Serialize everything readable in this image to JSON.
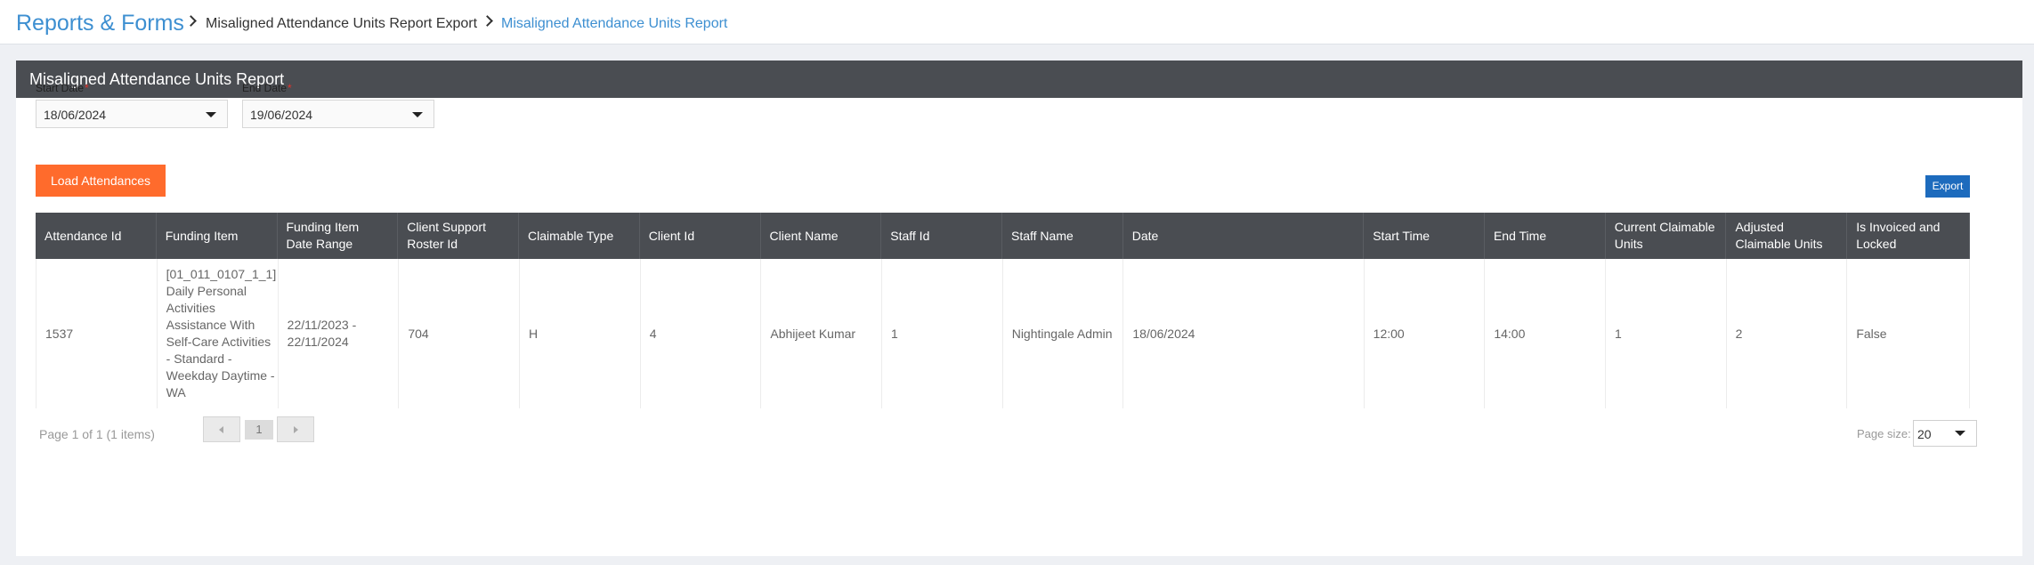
{
  "breadcrumb": {
    "app": "Reports & Forms",
    "items": [
      "Misaligned Attendance Units Report Export",
      "Misaligned Attendance Units Report"
    ]
  },
  "panel": {
    "title": "Misaligned Attendance Units Report"
  },
  "filters": {
    "start_label": "Start Date",
    "start_value": "18/06/2024",
    "end_label": "End Date",
    "end_value": "19/06/2024",
    "required_marker": "*"
  },
  "buttons": {
    "load": "Load Attendances",
    "export": "Export"
  },
  "table": {
    "columns": [
      "Attendance Id",
      "Funding Item",
      "Funding Item Date Range",
      "Client Support Roster Id",
      "Claimable Type",
      "Client Id",
      "Client Name",
      "Staff Id",
      "Staff Name",
      "Date",
      "Start Time",
      "End Time",
      "Current Claimable Units",
      "Adjusted Claimable Units",
      "Is Invoiced and Locked"
    ],
    "rows": [
      [
        "1537",
        "[01_011_0107_1_1] Daily Personal Activities Assistance With Self-Care Activities - Standard - Weekday Daytime - WA",
        "22/11/2023 - 22/11/2024",
        "704",
        "H",
        "4",
        "Abhijeet Kumar",
        "1",
        "Nightingale Admin",
        "18/06/2024",
        "12:00",
        "14:00",
        "1",
        "2",
        "False"
      ]
    ]
  },
  "pager": {
    "info": "Page 1 of 1 (1 items)",
    "current_page": "1",
    "page_size_label": "Page size:",
    "page_size": "20"
  },
  "colors": {
    "accent": "#3d8fd1",
    "header": "#4a4d52",
    "load_button": "#ff6b2c",
    "export_button": "#1d6bbd"
  }
}
